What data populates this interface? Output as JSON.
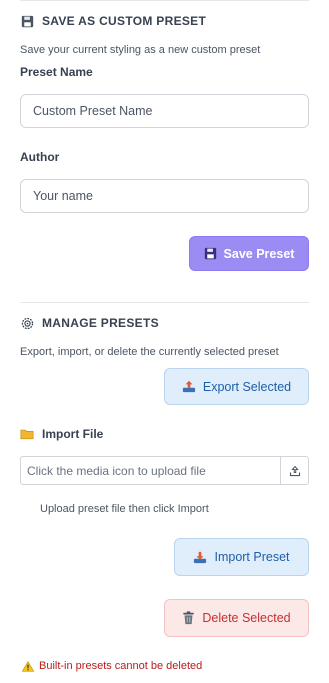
{
  "save_section": {
    "title": "SAVE AS CUSTOM PRESET",
    "description": "Save your current styling as a new custom preset",
    "preset_name_label": "Preset Name",
    "preset_name_placeholder": "Custom Preset Name",
    "author_label": "Author",
    "author_placeholder": "Your name",
    "save_button_label": "Save Preset",
    "title_icon": "floppy-disk-icon",
    "save_button_icon": "floppy-disk-icon"
  },
  "manage_section": {
    "title": "MANAGE PRESETS",
    "title_icon": "gear-icon",
    "description": "Export, import, or delete the currently selected preset",
    "export_button_label": "Export Selected",
    "export_button_icon": "upload-tray-icon",
    "import_file_label": "Import File",
    "import_file_icon": "folder-icon",
    "file_placeholder": "Click the media icon to upload file",
    "media_button_icon": "upload-tray-icon",
    "upload_hint": "Upload preset file then click Import",
    "import_button_label": "Import Preset",
    "import_button_icon": "download-tray-icon",
    "delete_button_label": "Delete Selected",
    "delete_button_icon": "trash-icon",
    "warning_text": "Built-in presets cannot be deleted",
    "warning_icon": "warning-icon"
  },
  "colors": {
    "save_button": "#9b8cf4",
    "export_button": "#e0eefb",
    "delete_button": "#fde8e8",
    "warning_text": "#b91c1c"
  }
}
